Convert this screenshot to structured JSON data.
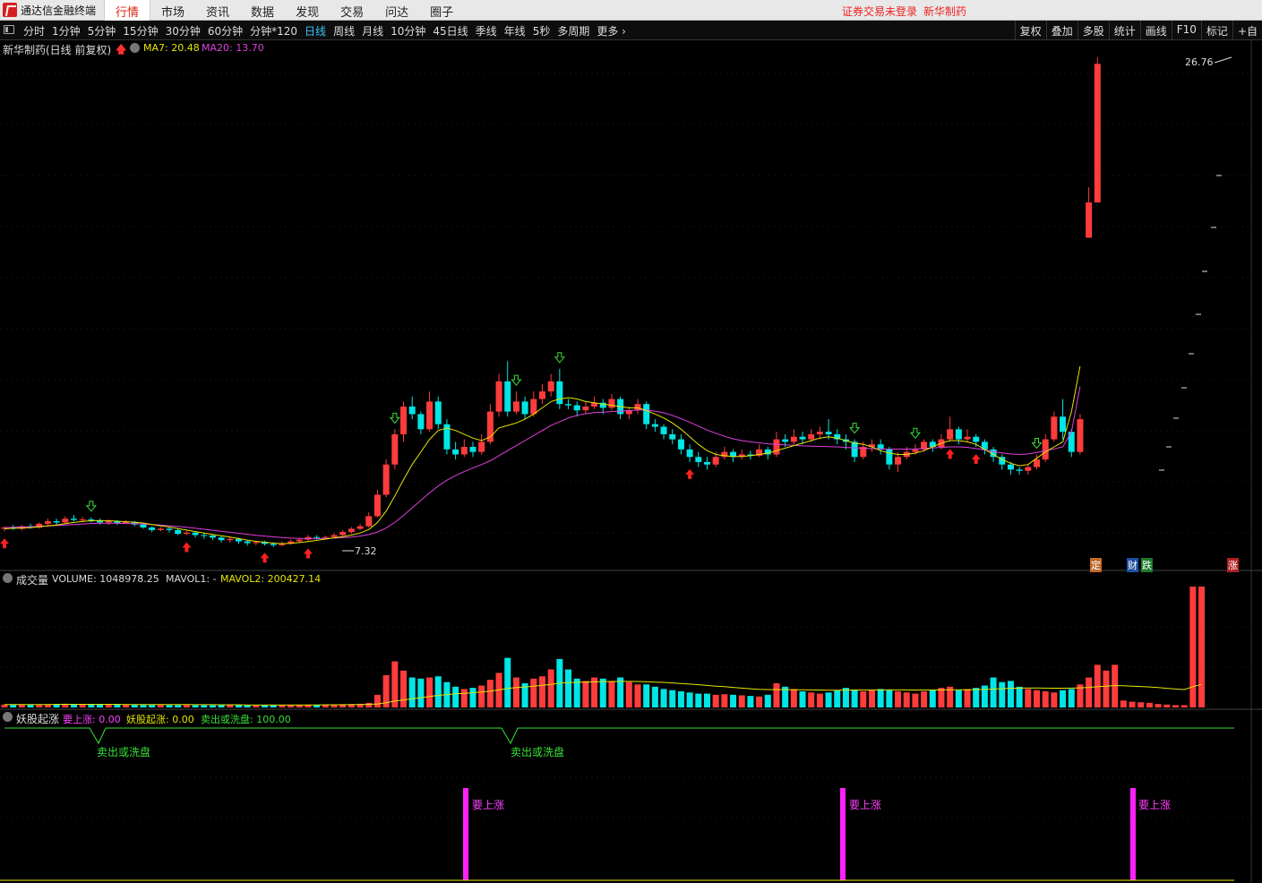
{
  "app": {
    "name": "通达信金融终端",
    "menu": [
      "行情",
      "市场",
      "资讯",
      "数据",
      "发现",
      "交易",
      "问达",
      "圈子"
    ],
    "active_menu": "行情",
    "login_status": "证券交易未登录",
    "stock_title": "新华制药"
  },
  "toolbar": {
    "periods": [
      "分时",
      "1分钟",
      "5分钟",
      "15分钟",
      "30分钟",
      "60分钟",
      "分钟*120",
      "日线",
      "周线",
      "月线",
      "10分钟",
      "45日线",
      "季线",
      "年线",
      "5秒",
      "多周期",
      "更多 ›"
    ],
    "active_period": "日线",
    "right_tools": [
      "复权",
      "叠加",
      "多股",
      "统计",
      "画线",
      "F10",
      "标记",
      "+自"
    ]
  },
  "main_panel": {
    "title": "新华制药(日线 前复权)",
    "ma7_label": "MA7: 20.48",
    "ma20_label": "MA20: 13.70",
    "high_label": "26.76",
    "low_label": "7.32",
    "badges": [
      "定",
      "财",
      "跌",
      "涨"
    ]
  },
  "volume_panel": {
    "name": "成交量",
    "volume_label": "VOLUME: 1048978.25",
    "mavol1_label": "MAVOL1: -",
    "mavol2_label": "MAVOL2: 200427.14"
  },
  "indicator_panel": {
    "name": "妖股起涨",
    "v1_label": "要上涨: 0.00",
    "v2_label": "妖股起涨: 0.00",
    "v3_label": "卖出或洗盘: 100.00",
    "sell_texts": [
      "卖出或洗盘",
      "卖出或洗盘"
    ],
    "rise_texts": [
      "要上涨",
      "要上涨",
      "要上涨"
    ]
  },
  "colors": {
    "up": "#ff3c3c",
    "down": "#00e5e5",
    "ma7": "#e6e600",
    "ma20": "#e040e0",
    "accent": "#38c6ff"
  },
  "chart_data": {
    "type": "candlestick",
    "title": "新华制药(日线 前复权)",
    "price_range": [
      7.32,
      26.76
    ],
    "annotations": [
      "26.76",
      "7.32"
    ],
    "candles": [
      [
        8.05,
        8.1,
        7.95,
        8.15
      ],
      [
        8.1,
        8.05,
        8.0,
        8.2
      ],
      [
        8.05,
        8.15,
        7.98,
        8.2
      ],
      [
        8.15,
        8.1,
        8.05,
        8.25
      ],
      [
        8.1,
        8.25,
        8.05,
        8.3
      ],
      [
        8.25,
        8.35,
        8.15,
        8.45
      ],
      [
        8.35,
        8.3,
        8.2,
        8.45
      ],
      [
        8.3,
        8.45,
        8.25,
        8.55
      ],
      [
        8.45,
        8.4,
        8.35,
        8.6
      ],
      [
        8.4,
        8.42,
        8.3,
        8.52
      ],
      [
        8.42,
        8.38,
        8.3,
        8.5
      ],
      [
        8.38,
        8.3,
        8.22,
        8.45
      ],
      [
        8.3,
        8.35,
        8.2,
        8.42
      ],
      [
        8.35,
        8.28,
        8.2,
        8.4
      ],
      [
        8.28,
        8.32,
        8.25,
        8.4
      ],
      [
        8.32,
        8.22,
        8.15,
        8.36
      ],
      [
        8.22,
        8.1,
        8.05,
        8.28
      ],
      [
        8.1,
        8.0,
        7.92,
        8.15
      ],
      [
        8.0,
        8.05,
        7.95,
        8.12
      ],
      [
        8.05,
        8.0,
        7.9,
        8.1
      ],
      [
        8.0,
        7.85,
        7.8,
        8.05
      ],
      [
        7.85,
        7.9,
        7.8,
        7.98
      ],
      [
        7.9,
        7.8,
        7.7,
        7.95
      ],
      [
        7.8,
        7.78,
        7.65,
        7.9
      ],
      [
        7.78,
        7.7,
        7.6,
        7.85
      ],
      [
        7.7,
        7.6,
        7.5,
        7.75
      ],
      [
        7.6,
        7.65,
        7.5,
        7.72
      ],
      [
        7.65,
        7.55,
        7.45,
        7.7
      ],
      [
        7.55,
        7.48,
        7.38,
        7.6
      ],
      [
        7.48,
        7.52,
        7.4,
        7.58
      ],
      [
        7.52,
        7.45,
        7.38,
        7.58
      ],
      [
        7.45,
        7.4,
        7.32,
        7.52
      ],
      [
        7.4,
        7.48,
        7.35,
        7.55
      ],
      [
        7.48,
        7.55,
        7.42,
        7.62
      ],
      [
        7.55,
        7.62,
        7.5,
        7.7
      ],
      [
        7.62,
        7.72,
        7.55,
        7.8
      ],
      [
        7.72,
        7.7,
        7.62,
        7.8
      ],
      [
        7.7,
        7.72,
        7.65,
        7.78
      ],
      [
        7.72,
        7.8,
        7.68,
        7.88
      ],
      [
        7.8,
        7.92,
        7.75,
        8.0
      ],
      [
        7.92,
        8.05,
        7.85,
        8.12
      ],
      [
        8.05,
        8.15,
        8.0,
        8.25
      ],
      [
        8.15,
        8.55,
        8.1,
        8.7
      ],
      [
        8.55,
        9.4,
        8.5,
        9.6
      ],
      [
        9.4,
        10.6,
        9.3,
        10.8
      ],
      [
        10.6,
        11.8,
        10.4,
        12.0
      ],
      [
        11.8,
        12.9,
        11.5,
        13.1
      ],
      [
        12.9,
        12.6,
        12.4,
        13.3
      ],
      [
        12.6,
        12.0,
        11.8,
        12.7
      ],
      [
        12.0,
        13.1,
        11.9,
        13.5
      ],
      [
        13.1,
        12.2,
        12.0,
        13.3
      ],
      [
        12.2,
        11.2,
        11.0,
        12.4
      ],
      [
        11.2,
        11.0,
        10.8,
        11.5
      ],
      [
        11.0,
        11.3,
        10.9,
        11.6
      ],
      [
        11.3,
        11.1,
        10.9,
        11.5
      ],
      [
        11.1,
        11.5,
        11.0,
        11.8
      ],
      [
        11.5,
        12.7,
        11.4,
        13.0
      ],
      [
        12.7,
        13.9,
        12.5,
        14.2
      ],
      [
        13.9,
        12.7,
        12.5,
        14.7
      ],
      [
        12.7,
        13.1,
        12.6,
        13.5
      ],
      [
        13.1,
        12.6,
        12.4,
        13.3
      ],
      [
        12.6,
        13.2,
        12.5,
        13.5
      ],
      [
        13.2,
        13.5,
        13.0,
        13.8
      ],
      [
        13.5,
        13.9,
        13.3,
        14.2
      ],
      [
        13.9,
        13.0,
        12.8,
        14.4
      ],
      [
        13.0,
        12.95,
        12.8,
        13.2
      ],
      [
        12.95,
        12.75,
        12.5,
        13.1
      ],
      [
        12.75,
        12.9,
        12.6,
        13.1
      ],
      [
        12.9,
        13.05,
        12.8,
        13.3
      ],
      [
        13.05,
        12.85,
        12.6,
        13.2
      ],
      [
        12.85,
        13.2,
        12.75,
        13.4
      ],
      [
        13.2,
        12.6,
        12.4,
        13.3
      ],
      [
        12.6,
        12.75,
        12.4,
        12.9
      ],
      [
        12.75,
        13.0,
        12.6,
        13.2
      ],
      [
        13.0,
        12.2,
        12.0,
        13.1
      ],
      [
        12.2,
        12.1,
        11.9,
        12.4
      ],
      [
        12.1,
        11.8,
        11.6,
        12.2
      ],
      [
        11.8,
        11.6,
        11.4,
        12.0
      ],
      [
        11.6,
        11.2,
        11.0,
        11.8
      ],
      [
        11.2,
        10.9,
        10.7,
        11.4
      ],
      [
        10.9,
        10.7,
        10.5,
        11.1
      ],
      [
        10.7,
        10.6,
        10.4,
        10.9
      ],
      [
        10.6,
        10.9,
        10.5,
        11.1
      ],
      [
        10.9,
        11.1,
        10.8,
        11.3
      ],
      [
        11.1,
        10.9,
        10.7,
        11.2
      ],
      [
        10.9,
        11.0,
        10.8,
        11.2
      ],
      [
        11.0,
        10.95,
        10.8,
        11.15
      ],
      [
        10.95,
        11.2,
        10.9,
        11.4
      ],
      [
        11.2,
        11.0,
        10.8,
        11.3
      ],
      [
        11.0,
        11.6,
        10.9,
        11.9
      ],
      [
        11.6,
        11.5,
        11.3,
        11.8
      ],
      [
        11.5,
        11.7,
        11.4,
        12.0
      ],
      [
        11.7,
        11.6,
        11.4,
        11.9
      ],
      [
        11.6,
        11.8,
        11.5,
        12.0
      ],
      [
        11.8,
        11.9,
        11.6,
        12.1
      ],
      [
        11.9,
        11.8,
        11.6,
        12.4
      ],
      [
        11.8,
        11.6,
        11.4,
        12.0
      ],
      [
        11.6,
        11.5,
        11.2,
        11.8
      ],
      [
        11.5,
        10.9,
        10.7,
        11.6
      ],
      [
        10.9,
        11.3,
        10.8,
        11.5
      ],
      [
        11.3,
        11.4,
        11.1,
        11.6
      ],
      [
        11.4,
        11.2,
        11.0,
        11.6
      ],
      [
        11.2,
        10.6,
        10.4,
        11.3
      ],
      [
        10.6,
        10.9,
        10.3,
        11.1
      ],
      [
        10.9,
        11.1,
        10.8,
        11.3
      ],
      [
        11.1,
        11.2,
        11.0,
        11.4
      ],
      [
        11.2,
        11.5,
        11.1,
        11.6
      ],
      [
        11.5,
        11.3,
        11.1,
        11.6
      ],
      [
        11.3,
        11.6,
        11.2,
        11.8
      ],
      [
        11.6,
        12.0,
        11.5,
        12.5
      ],
      [
        12.0,
        11.6,
        11.4,
        12.1
      ],
      [
        11.6,
        11.7,
        11.5,
        12.0
      ],
      [
        11.7,
        11.5,
        11.3,
        11.8
      ],
      [
        11.5,
        11.2,
        11.0,
        11.6
      ],
      [
        11.2,
        10.9,
        10.7,
        11.3
      ],
      [
        10.9,
        10.6,
        10.4,
        11.0
      ],
      [
        10.6,
        10.4,
        10.2,
        10.7
      ],
      [
        10.4,
        10.35,
        10.2,
        10.5
      ],
      [
        10.35,
        10.5,
        10.2,
        10.6
      ],
      [
        10.5,
        10.8,
        10.4,
        11.0
      ],
      [
        10.8,
        11.6,
        10.7,
        11.8
      ],
      [
        11.6,
        12.5,
        11.5,
        12.7
      ],
      [
        12.5,
        11.9,
        11.6,
        13.2
      ],
      [
        11.9,
        11.1,
        10.9,
        12.0
      ],
      [
        11.1,
        12.4,
        11.0,
        12.6
      ],
      [
        19.6,
        21.0,
        19.6,
        21.6
      ],
      [
        21.0,
        26.5,
        21.0,
        26.76
      ]
    ],
    "ma7": [
      8.05,
      8.07,
      8.08,
      8.1,
      8.13,
      8.17,
      8.2,
      8.25,
      8.3,
      8.34,
      8.37,
      8.38,
      8.37,
      8.35,
      8.33,
      8.31,
      8.28,
      8.22,
      8.17,
      8.12,
      8.06,
      8.0,
      7.94,
      7.88,
      7.82,
      7.77,
      7.72,
      7.66,
      7.6,
      7.55,
      7.52,
      7.48,
      7.46,
      7.47,
      7.5,
      7.54,
      7.59,
      7.64,
      7.69,
      7.74,
      7.8,
      7.88,
      8.02,
      8.3,
      8.75,
      9.35,
      10.0,
      10.6,
      11.1,
      11.6,
      11.95,
      12.05,
      11.95,
      11.8,
      11.65,
      11.55,
      11.7,
      12.05,
      12.15,
      12.25,
      12.4,
      12.6,
      12.85,
      13.1,
      13.2,
      13.25,
      13.2,
      13.1,
      13.05,
      13.0,
      12.95,
      12.9,
      12.85,
      12.85,
      12.75,
      12.6,
      12.45,
      12.25,
      12.0,
      11.7,
      11.4,
      11.15,
      11.0,
      10.95,
      10.92,
      10.92,
      10.95,
      11.0,
      11.05,
      11.15,
      11.25,
      11.35,
      11.45,
      11.55,
      11.65,
      11.7,
      11.65,
      11.55,
      11.45,
      11.4,
      11.3,
      11.15,
      11.05,
      11.0,
      11.0,
      11.05,
      11.15,
      11.3,
      11.45,
      11.55,
      11.55,
      11.5,
      11.4,
      11.2,
      11.0,
      10.8,
      10.65,
      10.55,
      10.6,
      10.85,
      11.1,
      11.3,
      11.5,
      12.7,
      14.5
    ],
    "ma20": [
      8.1,
      8.11,
      8.12,
      8.13,
      8.14,
      8.16,
      8.18,
      8.2,
      8.22,
      8.24,
      8.26,
      8.27,
      8.27,
      8.27,
      8.26,
      8.25,
      8.24,
      8.22,
      8.2,
      8.17,
      8.14,
      8.11,
      8.07,
      8.03,
      7.99,
      7.95,
      7.91,
      7.87,
      7.83,
      7.79,
      7.76,
      7.73,
      7.7,
      7.68,
      7.67,
      7.66,
      7.66,
      7.67,
      7.68,
      7.7,
      7.72,
      7.76,
      7.82,
      7.92,
      8.08,
      8.3,
      8.58,
      8.88,
      9.18,
      9.48,
      9.75,
      9.98,
      10.16,
      10.32,
      10.46,
      10.6,
      10.75,
      10.95,
      11.15,
      11.35,
      11.55,
      11.75,
      11.95,
      12.15,
      12.3,
      12.45,
      12.55,
      12.62,
      12.66,
      12.68,
      12.7,
      12.72,
      12.74,
      12.76,
      12.76,
      12.72,
      12.65,
      12.55,
      12.42,
      12.28,
      12.12,
      11.97,
      11.84,
      11.72,
      11.62,
      11.55,
      11.5,
      11.46,
      11.42,
      11.4,
      11.38,
      11.36,
      11.34,
      11.33,
      11.32,
      11.31,
      11.3,
      11.28,
      11.26,
      11.25,
      11.23,
      11.22,
      11.21,
      11.21,
      11.21,
      11.22,
      11.24,
      11.26,
      11.28,
      11.3,
      11.3,
      11.28,
      11.24,
      11.18,
      11.12,
      11.06,
      11.02,
      11.0,
      11.02,
      11.08,
      11.15,
      11.22,
      11.3,
      11.9,
      13.7
    ],
    "volume": [
      25,
      26,
      25,
      27,
      26,
      28,
      30,
      32,
      30,
      28,
      27,
      26,
      25,
      24,
      25,
      24,
      23,
      22,
      22,
      21,
      21,
      22,
      21,
      20,
      20,
      20,
      21,
      20,
      19,
      19,
      20,
      20,
      21,
      22,
      24,
      25,
      25,
      26,
      27,
      29,
      30,
      32,
      40,
      110,
      280,
      400,
      320,
      260,
      250,
      260,
      270,
      220,
      180,
      160,
      170,
      190,
      240,
      300,
      430,
      260,
      210,
      250,
      270,
      330,
      420,
      330,
      250,
      230,
      260,
      250,
      230,
      260,
      220,
      200,
      200,
      180,
      160,
      150,
      140,
      130,
      120,
      120,
      110,
      115,
      110,
      105,
      100,
      95,
      110,
      210,
      180,
      160,
      140,
      130,
      120,
      130,
      150,
      170,
      150,
      140,
      150,
      160,
      150,
      140,
      130,
      120,
      140,
      150,
      170,
      180,
      150,
      160,
      170,
      190,
      260,
      220,
      230,
      180,
      160,
      150,
      140,
      130,
      150,
      160,
      200,
      260,
      370,
      320,
      370,
      60,
      50,
      45,
      40,
      30,
      25,
      20,
      20,
      1048,
      1048
    ],
    "mavol2": [
      26,
      26,
      26,
      26,
      26,
      26,
      27,
      27,
      27,
      27,
      27,
      27,
      27,
      27,
      26,
      26,
      26,
      26,
      25,
      25,
      25,
      25,
      24,
      24,
      24,
      23,
      23,
      23,
      22,
      22,
      22,
      22,
      22,
      22,
      22,
      22,
      22,
      23,
      23,
      23,
      24,
      25,
      27,
      30,
      40,
      55,
      65,
      75,
      85,
      95,
      105,
      112,
      118,
      123,
      128,
      134,
      142,
      152,
      165,
      172,
      178,
      185,
      192,
      200,
      210,
      215,
      218,
      220,
      222,
      224,
      225,
      226,
      226,
      225,
      223,
      220,
      217,
      213,
      208,
      203,
      197,
      191,
      185,
      180,
      174,
      168,
      162,
      157,
      155,
      155,
      155,
      154,
      153,
      152,
      151,
      150,
      150,
      151,
      151,
      151,
      151,
      152,
      152,
      152,
      152,
      151,
      151,
      151,
      152,
      153,
      153,
      154,
      155,
      156,
      160,
      163,
      166,
      168,
      169,
      169,
      168,
      167,
      167,
      168,
      170,
      174,
      180,
      185,
      190,
      188,
      185,
      182,
      178,
      172,
      166,
      160,
      155,
      180,
      200
    ],
    "indicator": {
      "sell_or_wash_dips": [
        "卖出或洗盘",
        "卖出或洗盘"
      ],
      "rise_signals": [
        "要上涨",
        "要上涨",
        "要上涨"
      ]
    }
  }
}
